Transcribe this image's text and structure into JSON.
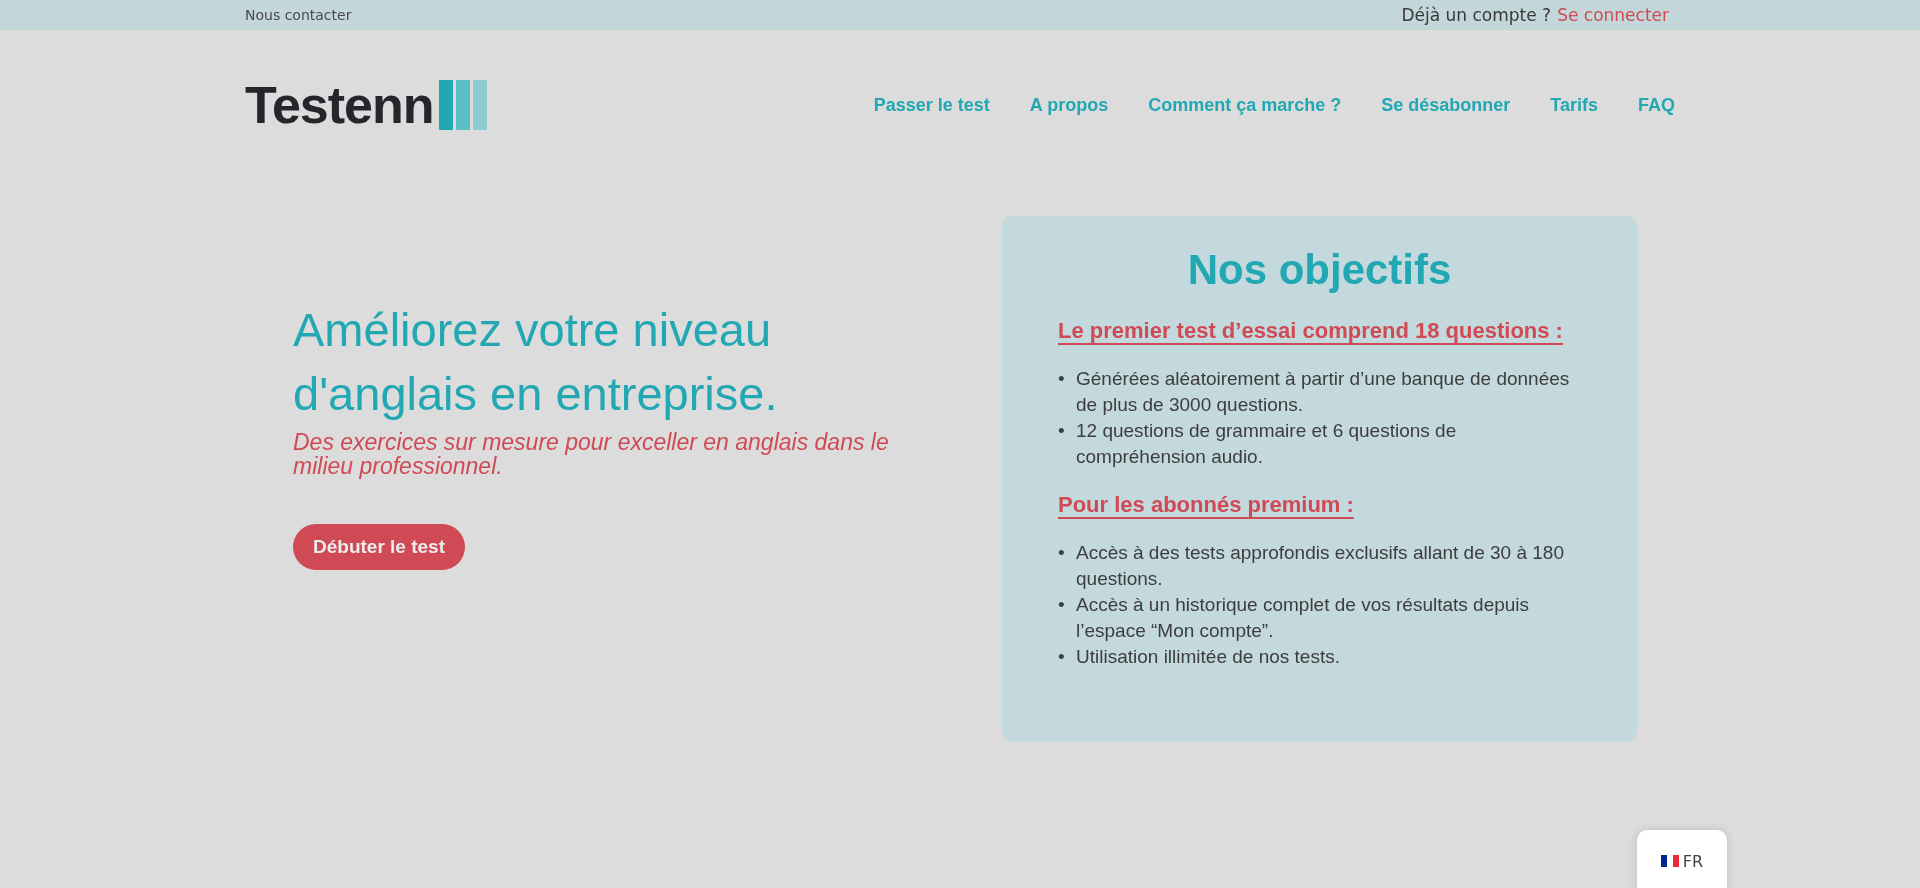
{
  "top_bar": {
    "contact_link": "Nous contacter",
    "account_prompt": "Déjà un compte ?",
    "login_link": "Se connecter"
  },
  "header": {
    "logo": "Testenn",
    "nav": [
      "Passer le test",
      "A propos",
      "Comment ça marche ?",
      "Se désabonner",
      "Tarifs",
      "FAQ"
    ]
  },
  "hero": {
    "title": "Améliorez votre niveau d'anglais en entreprise.",
    "subtitle": "Des exercices sur mesure pour exceller en anglais dans le milieu professionnel.",
    "button": "Débuter le test"
  },
  "objectives": {
    "title": "Nos objectifs",
    "bullet": "•",
    "sections": [
      {
        "heading": "Le premier test d’essai comprend 18 questions :",
        "items": [
          "Générées aléatoirement à partir d’une banque de données de plus de 3000 questions.",
          "12 questions de grammaire et 6 questions de compréhension audio."
        ]
      },
      {
        "heading": "Pour les abonnés premium :",
        "items": [
          "Accès à des tests approfondis exclusifs  allant de 30 à 180 questions.",
          "Accès à un historique complet de vos résultats depuis l’espace “Mon compte”.",
          "Utilisation illimitée de nos tests."
        ]
      }
    ]
  },
  "language_switcher": {
    "label": "FR"
  }
}
